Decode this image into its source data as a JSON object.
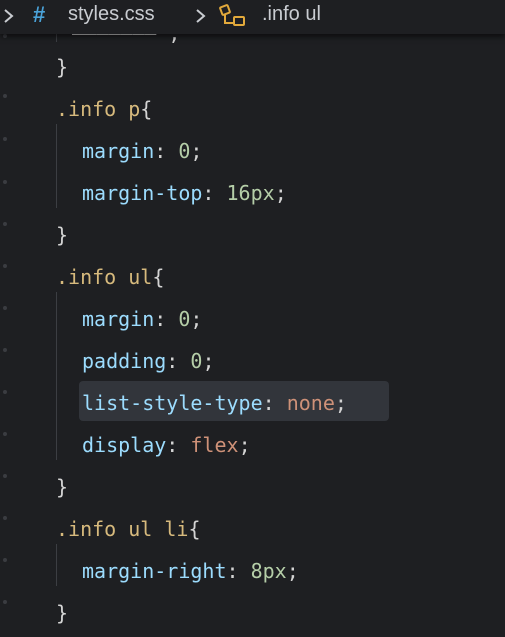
{
  "breadcrumb": {
    "file_icon": "#",
    "file_name": "styles.css",
    "symbol_name": ".info ul"
  },
  "icons": {
    "left": "chevron-right-icon",
    "separator": "chevron-right-icon",
    "symbol": "css-selector-symbol-icon"
  },
  "code": {
    "l1_close": "}",
    "l2_sel": ".info p",
    "l2_open": "{",
    "l3_prop": "margin",
    "l3_colon": ": ",
    "l3_val": "0",
    "l3_semi": ";",
    "l4_prop": "margin-top",
    "l4_colon": ": ",
    "l4_val": "16px",
    "l4_semi": ";",
    "l5_close": "}",
    "l6_sel": ".info ul",
    "l6_open": "{",
    "l7_prop": "margin",
    "l7_colon": ": ",
    "l7_val": "0",
    "l7_semi": ";",
    "l8_prop": "padding",
    "l8_colon": ": ",
    "l8_val": "0",
    "l8_semi": ";",
    "l9_prop": "list-style-type",
    "l9_colon": ": ",
    "l9_val": "none",
    "l9_semi": ";",
    "l10_prop": "display",
    "l10_colon": ": ",
    "l10_val": "flex",
    "l10_semi": ";",
    "l11_close": "}",
    "l12_sel": ".info ul li",
    "l12_open": "{",
    "l13_prop": "margin-right",
    "l13_colon": ": ",
    "l13_val": "8px",
    "l13_semi": ";",
    "l14_close": "}"
  },
  "colors": {
    "background": "#1e1f22",
    "selector": "#d7ba7d",
    "property": "#9cdcfe",
    "number": "#b5cea8",
    "keyword": "#ce9178",
    "hash_icon": "#4aa2d8",
    "symbol_icon": "#e2a93b"
  }
}
